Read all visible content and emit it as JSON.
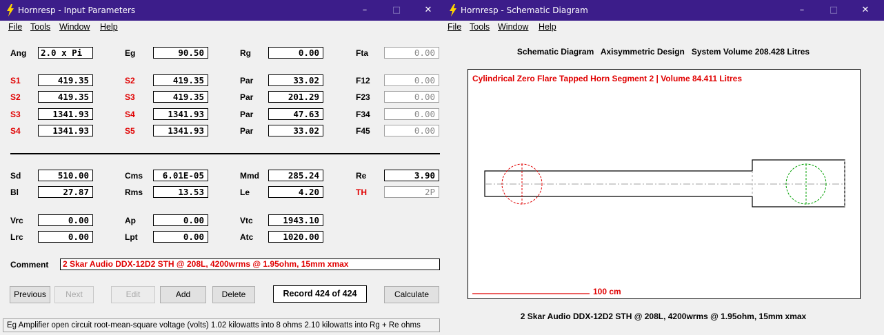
{
  "input_window": {
    "title": "Hornresp - Input Parameters",
    "controls": {
      "minimize": "–",
      "maximize": "□",
      "close": "✕"
    },
    "menu": [
      "File",
      "Tools",
      "Window",
      "Help"
    ],
    "rows": {
      "ang": {
        "label": "Ang",
        "value": "2.0 x Pi"
      },
      "eg": {
        "label": "Eg",
        "value": "90.50"
      },
      "rg": {
        "label": "Rg",
        "value": "0.00"
      },
      "fta": {
        "label": "Fta",
        "value": "0.00"
      },
      "s1": {
        "label": "S1",
        "value": "419.35"
      },
      "s2a": {
        "label": "S2",
        "value": "419.35"
      },
      "par1": {
        "label": "Par",
        "value": "33.02"
      },
      "f12": {
        "label": "F12",
        "value": "0.00"
      },
      "s2b": {
        "label": "S2",
        "value": "419.35"
      },
      "s3a": {
        "label": "S3",
        "value": "419.35"
      },
      "par2": {
        "label": "Par",
        "value": "201.29"
      },
      "f23": {
        "label": "F23",
        "value": "0.00"
      },
      "s3b": {
        "label": "S3",
        "value": "1341.93"
      },
      "s4a": {
        "label": "S4",
        "value": "1341.93"
      },
      "par3": {
        "label": "Par",
        "value": "47.63"
      },
      "f34": {
        "label": "F34",
        "value": "0.00"
      },
      "s4b": {
        "label": "S4",
        "value": "1341.93"
      },
      "s5": {
        "label": "S5",
        "value": "1341.93"
      },
      "par4": {
        "label": "Par",
        "value": "33.02"
      },
      "f45": {
        "label": "F45",
        "value": "0.00"
      },
      "sd": {
        "label": "Sd",
        "value": "510.00"
      },
      "cms": {
        "label": "Cms",
        "value": "6.01E-05"
      },
      "mmd": {
        "label": "Mmd",
        "value": "285.24"
      },
      "re": {
        "label": "Re",
        "value": "3.90"
      },
      "bl": {
        "label": "Bl",
        "value": "27.87"
      },
      "rms": {
        "label": "Rms",
        "value": "13.53"
      },
      "le": {
        "label": "Le",
        "value": "4.20"
      },
      "th": {
        "label": "TH",
        "value": "2P"
      },
      "vrc": {
        "label": "Vrc",
        "value": "0.00"
      },
      "ap": {
        "label": "Ap",
        "value": "0.00"
      },
      "vtc": {
        "label": "Vtc",
        "value": "1943.10"
      },
      "lrc": {
        "label": "Lrc",
        "value": "0.00"
      },
      "lpt": {
        "label": "Lpt",
        "value": "0.00"
      },
      "atc": {
        "label": "Atc",
        "value": "1020.00"
      }
    },
    "comment": {
      "label": "Comment",
      "value": "2 Skar Audio DDX-12D2 STH @ 208L, 4200wrms @ 1.95ohm, 15mm xmax"
    },
    "buttons": {
      "previous": "Previous",
      "next": "Next",
      "edit": "Edit",
      "add": "Add",
      "delete": "Delete",
      "calculate": "Calculate"
    },
    "record": "Record 424 of 424",
    "status": "Eg  Amplifier open circuit root-mean-square voltage  (volts)   1.02 kilowatts into 8 ohms   2.10 kilowatts into Rg + Re ohms"
  },
  "schematic_window": {
    "title": "Hornresp - Schematic Diagram",
    "controls": {
      "minimize": "–",
      "maximize": "□",
      "close": "✕"
    },
    "menu": [
      "File",
      "Tools",
      "Window",
      "Help"
    ],
    "header": "Schematic Diagram   Axisymmetric Design   System Volume 208.428 Litres",
    "diagram_title": "Cylindrical Zero Flare Tapped Horn Segment 2 | Volume 84.411 Litres",
    "scale_label": "100 cm",
    "footer": "2 Skar Audio DDX-12D2 STH @ 208L, 4200wrms @ 1.95ohm, 15mm xmax"
  },
  "colors": {
    "titlebar": "#3c1d8a",
    "red_label": "#e00000",
    "green_driver": "#00a000",
    "window_bg": "#f0f0f0"
  }
}
